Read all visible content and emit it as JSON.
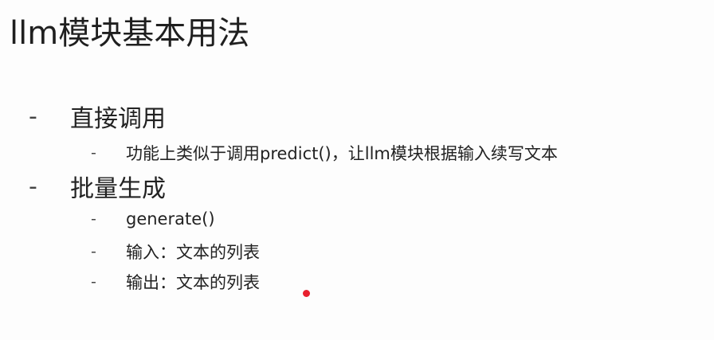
{
  "title": "llm模块基本用法",
  "bullet_marker": "-",
  "sections": [
    {
      "label": "直接调用",
      "items": [
        "功能上类似于调用predict()，让llm模块根据输入续写文本"
      ]
    },
    {
      "label": "批量生成",
      "items": [
        "generate()",
        "输入：文本的列表",
        "输出：文本的列表"
      ]
    }
  ],
  "pointer_color": "#e8202e"
}
